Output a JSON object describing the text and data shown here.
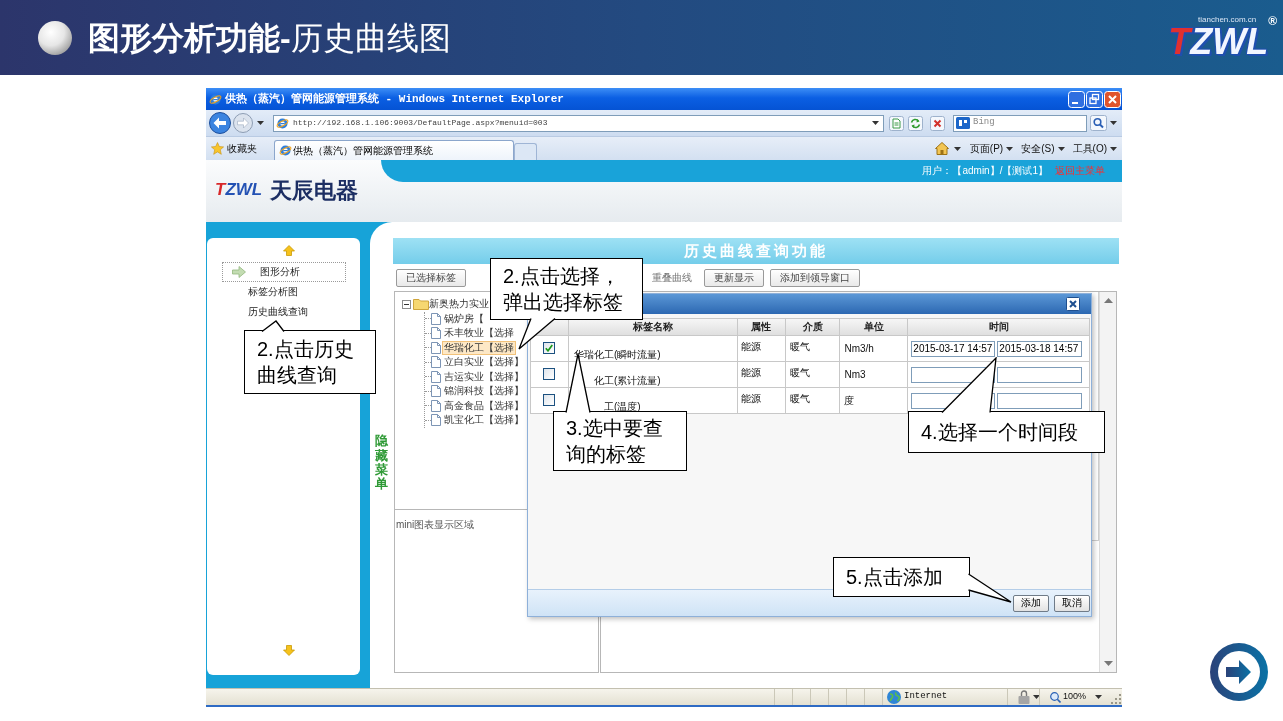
{
  "slide": {
    "title": "**图形分析功能-**历史曲线图",
    "logo": {
      "site": "tianchen.com.cn",
      "mark": "TZWL",
      "registered": "®"
    }
  },
  "browser": {
    "title": "供热（蒸汽）管网能源管理系统 - Windows Internet Explorer",
    "url": "http://192.168.1.106:9003/DefaultPage.aspx?menuid=003",
    "search_placeholder": "Bing",
    "favorites": "收藏夹",
    "tabs": [
      {
        "label": "供热（蒸汽）管网能源管理系统",
        "selected": true
      }
    ],
    "commands": [
      "页面(P)",
      "安全(S)",
      "工具(O)"
    ],
    "status": {
      "zone": "Internet",
      "zoom": "100%"
    }
  },
  "app": {
    "logo": {
      "mark": "TZWL",
      "name": "天辰电器"
    },
    "user_info": "用户：【admin】/【测试1】",
    "back_link": "返回主菜单",
    "menu": {
      "title": "图形分析",
      "items": [
        "标签分析图",
        "历史曲线查询"
      ]
    },
    "hide_menu": "隐藏菜单",
    "panel_title": "历史曲线查询功能",
    "toolbar": [
      {
        "kind": "button",
        "label": "已选择标签"
      },
      {
        "kind": "text",
        "label": "重叠曲线"
      },
      {
        "kind": "button",
        "label": "更新显示"
      },
      {
        "kind": "button",
        "label": "添加到领导窗口"
      }
    ],
    "tree": {
      "label": "新奥热力实业",
      "expanded": true,
      "children": [
        {
          "label": "锅炉房【",
          "selected": false
        },
        {
          "label": "禾丰牧业【选择",
          "selected": false
        },
        {
          "label": "华瑞化工【选择",
          "selected": true
        },
        {
          "label": "立白实业【选择】",
          "selected": false
        },
        {
          "label": "吉运实业【选择】",
          "selected": false
        },
        {
          "label": "锦润科技【选择】",
          "selected": false
        },
        {
          "label": "高金食品【选择】",
          "selected": false
        },
        {
          "label": "凯宝化工【选择】",
          "selected": false
        }
      ]
    },
    "mini_chart_label": "mini图表显示区域"
  },
  "dialog": {
    "columns": [
      "标签名称",
      "属性",
      "介质",
      "单位",
      "时间"
    ],
    "rows": [
      {
        "checked": true,
        "name": "华瑞化工(瞬时流量)",
        "attribute": "能源",
        "medium": "暖气",
        "unit": "Nm3/h",
        "start": "2015-03-17 14:57",
        "end": "2015-03-18 14:57"
      },
      {
        "checked": false,
        "name": "化工(累计流量)",
        "attribute": "能源",
        "medium": "暖气",
        "unit": "Nm3"
      },
      {
        "checked": false,
        "name": "工(温度)",
        "attribute": "能源",
        "medium": "暖气",
        "unit": "度"
      }
    ],
    "buttons": [
      "添加",
      "取消"
    ]
  },
  "callouts": [
    "2.点击历史曲线查询",
    "2.点击选择，弹出选择标签",
    "3.选中要查询的标签",
    "4.选择一个时间段",
    "5.点击添加"
  ]
}
